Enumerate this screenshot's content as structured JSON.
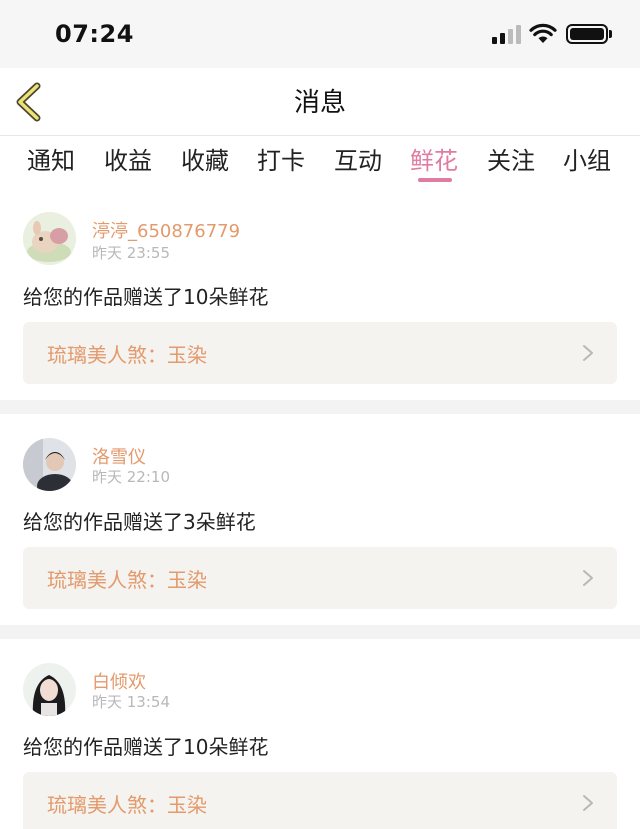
{
  "status_bar": {
    "time": "07:24",
    "icons": [
      "signal-icon",
      "wifi-icon",
      "battery-icon"
    ]
  },
  "nav": {
    "title": "消息",
    "back_icon": "chevron-left-icon"
  },
  "tabs": [
    {
      "label": "通知"
    },
    {
      "label": "收益"
    },
    {
      "label": "收藏"
    },
    {
      "label": "打卡"
    },
    {
      "label": "互动"
    },
    {
      "label": "鲜花",
      "active": true
    },
    {
      "label": "关注"
    },
    {
      "label": "小组"
    }
  ],
  "colors": {
    "accent": "#e07ba1",
    "username": "#e39a6c",
    "muted": "#b8b8b8",
    "link_bg": "#f4f3ef"
  },
  "items": [
    {
      "username": "渟渟_650876779",
      "time": "昨天 23:55",
      "message": "给您的作品赠送了10朵鲜花",
      "work_title": "琉璃美人煞：玉染"
    },
    {
      "username": "洛雪仪",
      "time": "昨天 22:10",
      "message": "给您的作品赠送了3朵鲜花",
      "work_title": "琉璃美人煞：玉染"
    },
    {
      "username": "白倾欢",
      "time": "昨天 13:54",
      "message": "给您的作品赠送了10朵鲜花",
      "work_title": "琉璃美人煞：玉染"
    }
  ]
}
